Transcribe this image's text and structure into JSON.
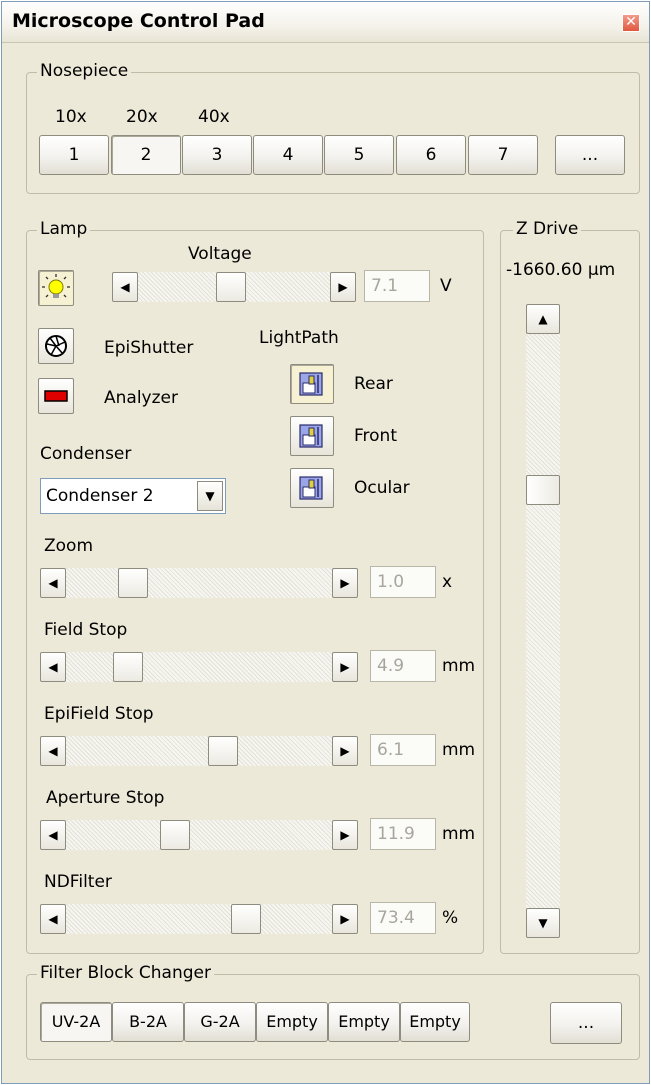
{
  "window": {
    "title": "Microscope Control Pad",
    "close_glyph": "✕"
  },
  "nosepiece": {
    "legend": "Nosepiece",
    "magnifications": [
      "10x",
      "20x",
      "40x"
    ],
    "positions": [
      "1",
      "2",
      "3",
      "4",
      "5",
      "6",
      "7"
    ],
    "selected": "2",
    "more_label": "..."
  },
  "lamp": {
    "legend": "Lamp",
    "voltage_label": "Voltage",
    "voltage_value": "7.1",
    "voltage_unit": "V",
    "voltage_fraction": 0.48,
    "lamp_icon": "lightbulb-icon",
    "epishutter_label": "EpiShutter",
    "epishutter_icon": "shutter-icon",
    "analyzer_label": "Analyzer",
    "analyzer_icon": "analyzer-icon",
    "lightpath_label": "LightPath",
    "lightpath_options": [
      "Rear",
      "Front",
      "Ocular"
    ],
    "lightpath_selected": "Rear",
    "condenser_label": "Condenser",
    "condenser_value": "Condenser 2",
    "sliders": [
      {
        "label": "Zoom",
        "value": "1.0",
        "unit": "x",
        "fraction": 0.22
      },
      {
        "label": "Field Stop",
        "value": "4.9",
        "unit": "mm",
        "fraction": 0.2
      },
      {
        "label": "EpiField Stop",
        "value": "6.1",
        "unit": "mm",
        "fraction": 0.6
      },
      {
        "label": "Aperture Stop",
        "value": "11.9",
        "unit": "mm",
        "fraction": 0.4
      },
      {
        "label": "NDFilter",
        "value": "73.4",
        "unit": "%",
        "fraction": 0.7
      }
    ]
  },
  "zdrive": {
    "legend": "Z Drive",
    "position_text": "-1660.60 µm",
    "fraction": 0.26
  },
  "filter_block": {
    "legend": "Filter Block Changer",
    "positions": [
      "UV-2A",
      "B-2A",
      "G-2A",
      "Empty",
      "Empty",
      "Empty"
    ],
    "selected": "UV-2A",
    "more_label": "..."
  },
  "colors": {
    "face": "#ece9d8",
    "close_red": "#e0593f",
    "analyzer_red": "#e00000"
  }
}
